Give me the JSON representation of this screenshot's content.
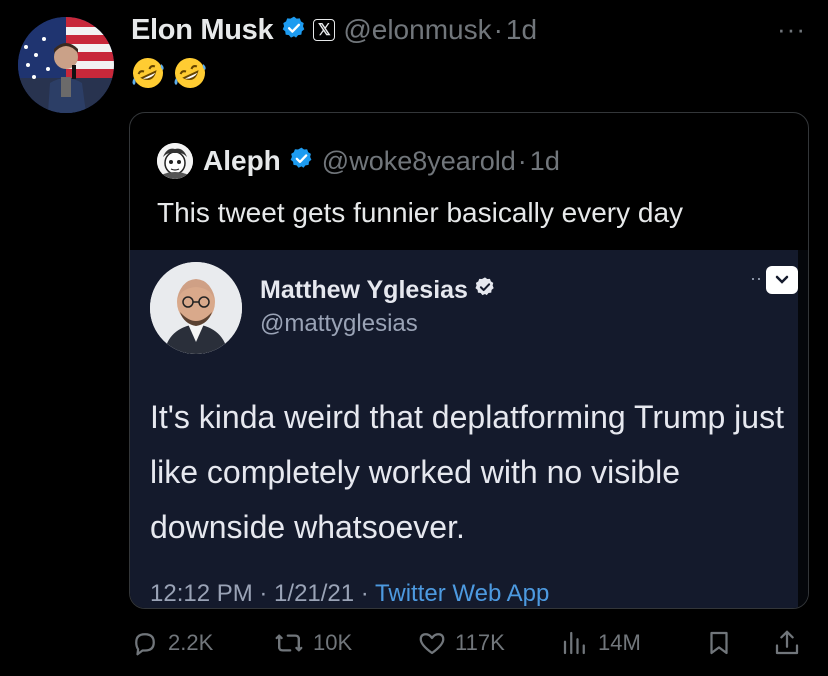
{
  "tweet": {
    "author_name": "Elon Musk",
    "author_handle": "@elonmusk",
    "time": "1d",
    "separator": "·",
    "emojis": [
      "rolling-on-floor-laughing-emoji",
      "rolling-on-floor-laughing-emoji"
    ],
    "more_icon": "more-icon"
  },
  "quote": {
    "author_name": "Aleph",
    "author_handle": "@woke8yearold",
    "time": "1d",
    "text": "This tweet gets funnier basically every day",
    "screenshot": {
      "author_name": "Matthew Yglesias",
      "author_handle": "@mattyglesias",
      "body": "It's kinda weird that deplatforming Trump just like completely worked with no visible downside whatsoever.",
      "meta_time": "12:12 PM · 1/21/21 · ",
      "meta_app": "Twitter Web App"
    }
  },
  "actions": {
    "replies": "2.2K",
    "retweets": "10K",
    "likes": "117K",
    "views": "14M"
  },
  "colors": {
    "background": "#000000",
    "text": "#e7e9ea",
    "muted": "#71767b",
    "verified": "#1d9bf0",
    "border": "#333639"
  }
}
